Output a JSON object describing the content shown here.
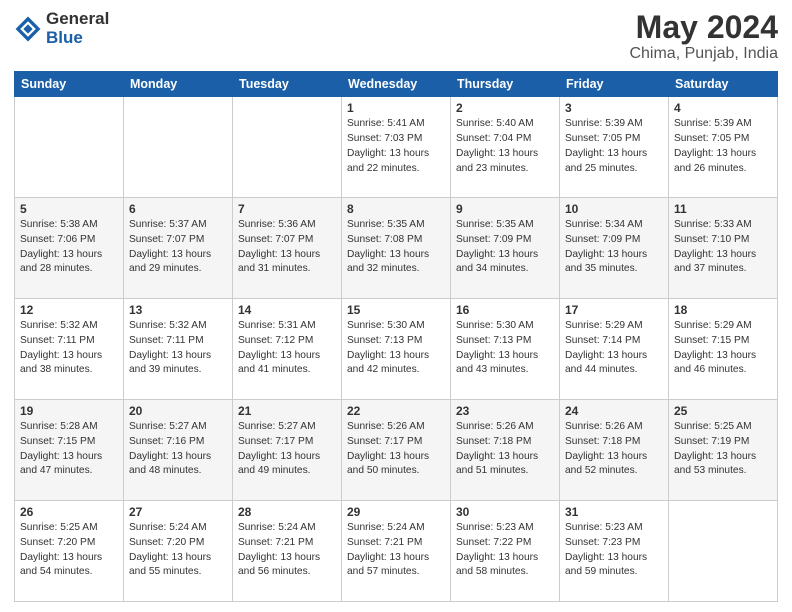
{
  "logo": {
    "general": "General",
    "blue": "Blue"
  },
  "header": {
    "title": "May 2024",
    "subtitle": "Chima, Punjab, India"
  },
  "weekdays": [
    "Sunday",
    "Monday",
    "Tuesday",
    "Wednesday",
    "Thursday",
    "Friday",
    "Saturday"
  ],
  "weeks": [
    [
      {
        "day": "",
        "content": ""
      },
      {
        "day": "",
        "content": ""
      },
      {
        "day": "",
        "content": ""
      },
      {
        "day": "1",
        "content": "Sunrise: 5:41 AM\nSunset: 7:03 PM\nDaylight: 13 hours\nand 22 minutes."
      },
      {
        "day": "2",
        "content": "Sunrise: 5:40 AM\nSunset: 7:04 PM\nDaylight: 13 hours\nand 23 minutes."
      },
      {
        "day": "3",
        "content": "Sunrise: 5:39 AM\nSunset: 7:05 PM\nDaylight: 13 hours\nand 25 minutes."
      },
      {
        "day": "4",
        "content": "Sunrise: 5:39 AM\nSunset: 7:05 PM\nDaylight: 13 hours\nand 26 minutes."
      }
    ],
    [
      {
        "day": "5",
        "content": "Sunrise: 5:38 AM\nSunset: 7:06 PM\nDaylight: 13 hours\nand 28 minutes."
      },
      {
        "day": "6",
        "content": "Sunrise: 5:37 AM\nSunset: 7:07 PM\nDaylight: 13 hours\nand 29 minutes."
      },
      {
        "day": "7",
        "content": "Sunrise: 5:36 AM\nSunset: 7:07 PM\nDaylight: 13 hours\nand 31 minutes."
      },
      {
        "day": "8",
        "content": "Sunrise: 5:35 AM\nSunset: 7:08 PM\nDaylight: 13 hours\nand 32 minutes."
      },
      {
        "day": "9",
        "content": "Sunrise: 5:35 AM\nSunset: 7:09 PM\nDaylight: 13 hours\nand 34 minutes."
      },
      {
        "day": "10",
        "content": "Sunrise: 5:34 AM\nSunset: 7:09 PM\nDaylight: 13 hours\nand 35 minutes."
      },
      {
        "day": "11",
        "content": "Sunrise: 5:33 AM\nSunset: 7:10 PM\nDaylight: 13 hours\nand 37 minutes."
      }
    ],
    [
      {
        "day": "12",
        "content": "Sunrise: 5:32 AM\nSunset: 7:11 PM\nDaylight: 13 hours\nand 38 minutes."
      },
      {
        "day": "13",
        "content": "Sunrise: 5:32 AM\nSunset: 7:11 PM\nDaylight: 13 hours\nand 39 minutes."
      },
      {
        "day": "14",
        "content": "Sunrise: 5:31 AM\nSunset: 7:12 PM\nDaylight: 13 hours\nand 41 minutes."
      },
      {
        "day": "15",
        "content": "Sunrise: 5:30 AM\nSunset: 7:13 PM\nDaylight: 13 hours\nand 42 minutes."
      },
      {
        "day": "16",
        "content": "Sunrise: 5:30 AM\nSunset: 7:13 PM\nDaylight: 13 hours\nand 43 minutes."
      },
      {
        "day": "17",
        "content": "Sunrise: 5:29 AM\nSunset: 7:14 PM\nDaylight: 13 hours\nand 44 minutes."
      },
      {
        "day": "18",
        "content": "Sunrise: 5:29 AM\nSunset: 7:15 PM\nDaylight: 13 hours\nand 46 minutes."
      }
    ],
    [
      {
        "day": "19",
        "content": "Sunrise: 5:28 AM\nSunset: 7:15 PM\nDaylight: 13 hours\nand 47 minutes."
      },
      {
        "day": "20",
        "content": "Sunrise: 5:27 AM\nSunset: 7:16 PM\nDaylight: 13 hours\nand 48 minutes."
      },
      {
        "day": "21",
        "content": "Sunrise: 5:27 AM\nSunset: 7:17 PM\nDaylight: 13 hours\nand 49 minutes."
      },
      {
        "day": "22",
        "content": "Sunrise: 5:26 AM\nSunset: 7:17 PM\nDaylight: 13 hours\nand 50 minutes."
      },
      {
        "day": "23",
        "content": "Sunrise: 5:26 AM\nSunset: 7:18 PM\nDaylight: 13 hours\nand 51 minutes."
      },
      {
        "day": "24",
        "content": "Sunrise: 5:26 AM\nSunset: 7:18 PM\nDaylight: 13 hours\nand 52 minutes."
      },
      {
        "day": "25",
        "content": "Sunrise: 5:25 AM\nSunset: 7:19 PM\nDaylight: 13 hours\nand 53 minutes."
      }
    ],
    [
      {
        "day": "26",
        "content": "Sunrise: 5:25 AM\nSunset: 7:20 PM\nDaylight: 13 hours\nand 54 minutes."
      },
      {
        "day": "27",
        "content": "Sunrise: 5:24 AM\nSunset: 7:20 PM\nDaylight: 13 hours\nand 55 minutes."
      },
      {
        "day": "28",
        "content": "Sunrise: 5:24 AM\nSunset: 7:21 PM\nDaylight: 13 hours\nand 56 minutes."
      },
      {
        "day": "29",
        "content": "Sunrise: 5:24 AM\nSunset: 7:21 PM\nDaylight: 13 hours\nand 57 minutes."
      },
      {
        "day": "30",
        "content": "Sunrise: 5:23 AM\nSunset: 7:22 PM\nDaylight: 13 hours\nand 58 minutes."
      },
      {
        "day": "31",
        "content": "Sunrise: 5:23 AM\nSunset: 7:23 PM\nDaylight: 13 hours\nand 59 minutes."
      },
      {
        "day": "",
        "content": ""
      }
    ]
  ]
}
